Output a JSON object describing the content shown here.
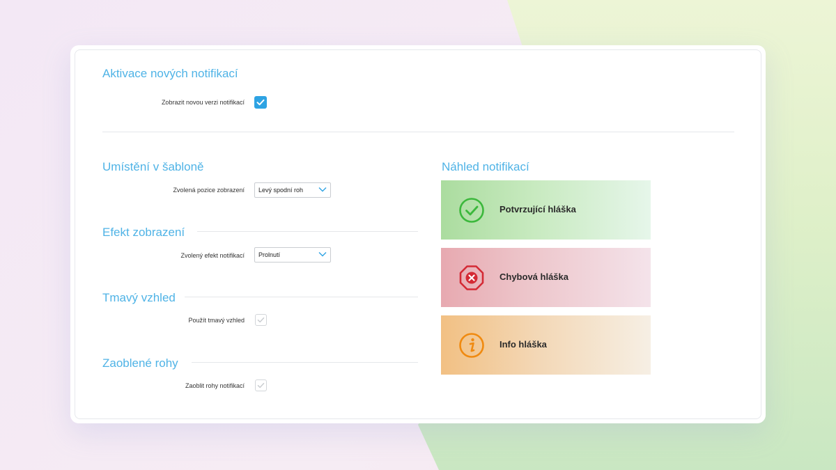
{
  "activation": {
    "title": "Aktivace nových notifikací",
    "show_new_label": "Zobrazit novou verzi notifikací",
    "show_new_checked": true
  },
  "placement": {
    "title": "Umístění v šabloně",
    "position_label": "Zvolená pozice zobrazení",
    "position_value": "Levý spodní roh"
  },
  "effect": {
    "title": "Efekt zobrazení",
    "effect_label": "Zvolený efekt notifikací",
    "effect_value": "Prolnutí"
  },
  "dark": {
    "title": "Tmavý vzhled",
    "dark_label": "Použít tmavý vzhled",
    "dark_checked": true,
    "dark_disabled": true
  },
  "rounded": {
    "title": "Zaoblené rohy",
    "rounded_label": "Zaoblit rohy notifikací",
    "rounded_checked": true,
    "rounded_disabled": true
  },
  "preview": {
    "title": "Náhled notifikací",
    "items": [
      {
        "label": "Potvrzující hláška",
        "icon": "check-circle-icon",
        "color": "#3cb83c"
      },
      {
        "label": "Chybová hláška",
        "icon": "error-octagon-icon",
        "color": "#d42a35"
      },
      {
        "label": "Info hláška",
        "icon": "info-circle-icon",
        "color": "#f08a10"
      }
    ]
  },
  "colors": {
    "accent": "#2ea3e3",
    "title": "#4fb3e6"
  }
}
